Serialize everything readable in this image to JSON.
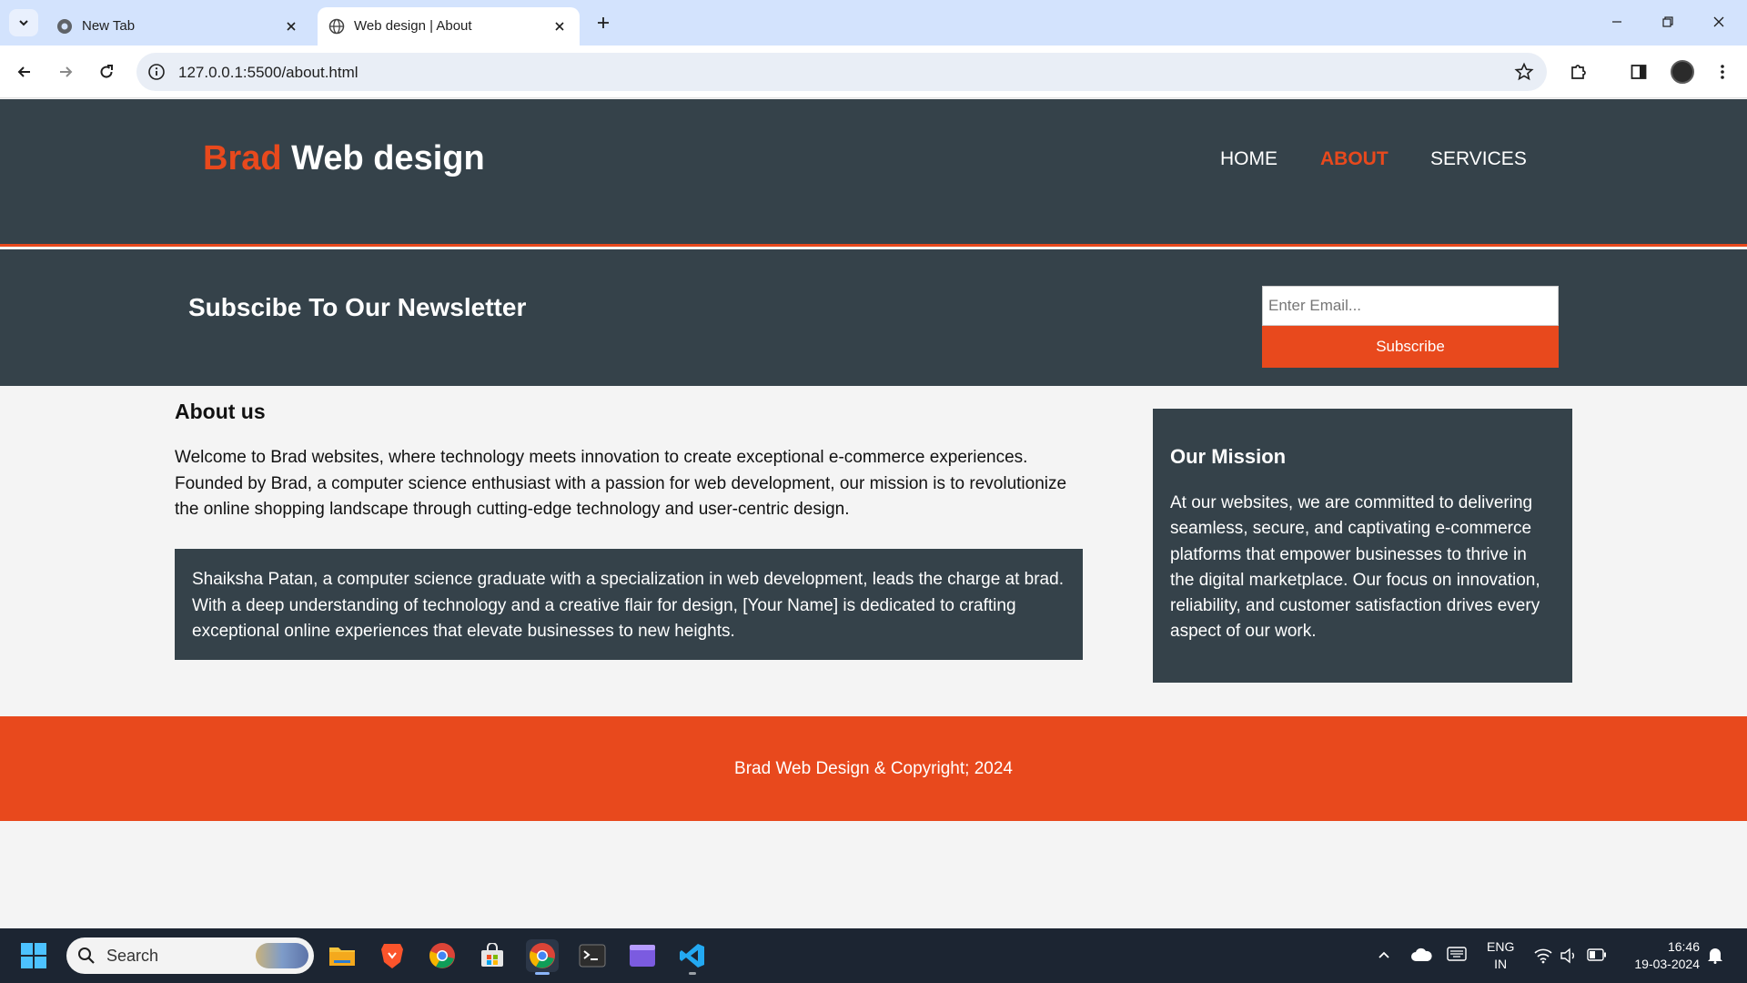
{
  "browser": {
    "tabs": [
      {
        "label": "New Tab",
        "active": false
      },
      {
        "label": "Web design | About",
        "active": true
      }
    ],
    "url": "127.0.0.1:5500/about.html"
  },
  "site": {
    "brand_highlight": "Brad",
    "brand_rest": " Web design",
    "nav": [
      {
        "label": "HOME",
        "current": false
      },
      {
        "label": "ABOUT",
        "current": true
      },
      {
        "label": "SERVICES",
        "current": false
      }
    ],
    "newsletter": {
      "heading": "Subscibe To Our Newsletter",
      "email_placeholder": "Enter Email...",
      "button_label": "Subscribe"
    },
    "about": {
      "heading": "About us",
      "intro": "Welcome to Brad websites, where technology meets innovation to create exceptional e-commerce experiences. Founded by Brad, a computer science enthusiast with a passion for web development, our mission is to revolutionize the online shopping landscape through cutting-edge technology and user-centric design.",
      "bio": "Shaiksha Patan, a computer science graduate with a specialization in web development, leads the charge at brad. With a deep understanding of technology and a creative flair for design, [Your Name] is dedicated to crafting exceptional online experiences that elevate businesses to new heights."
    },
    "mission": {
      "heading": "Our Mission",
      "text": "At our websites, we are committed to delivering seamless, secure, and captivating e-commerce platforms that empower businesses to thrive in the digital marketplace. Our focus on innovation, reliability, and customer satisfaction drives every aspect of our work."
    },
    "footer": "Brad Web Design & Copyright; 2024"
  },
  "taskbar": {
    "search_placeholder": "Search",
    "lang_line1": "ENG",
    "lang_line2": "IN",
    "time": "16:46",
    "date": "19-03-2024"
  },
  "colors": {
    "accent": "#e8491d",
    "dark": "#35424a",
    "background": "#f4f4f4"
  }
}
